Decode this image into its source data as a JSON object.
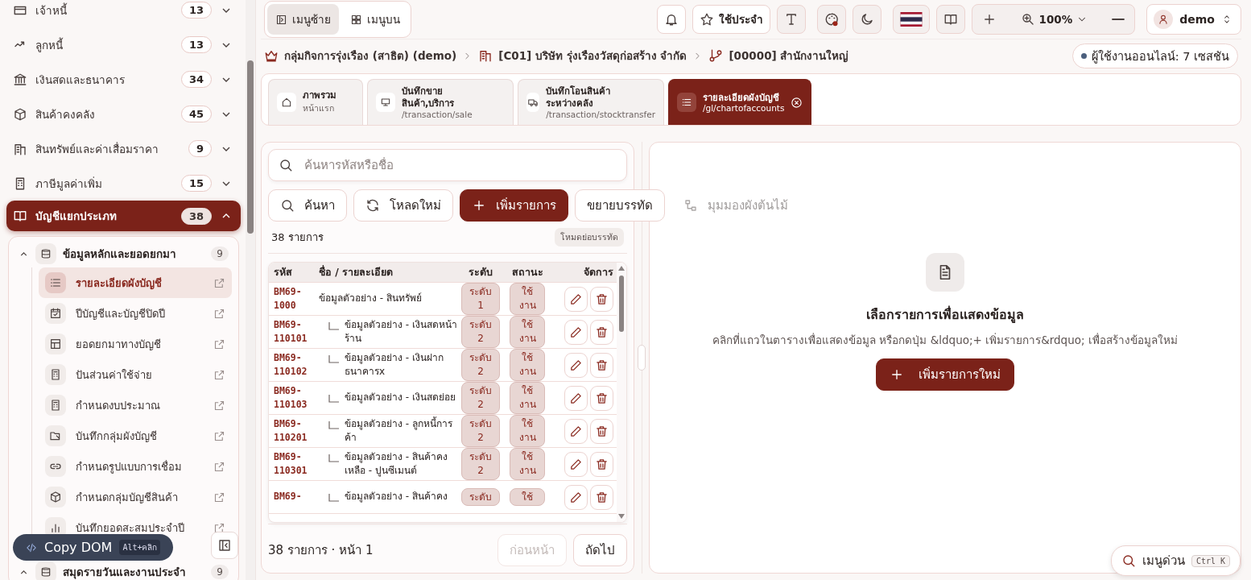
{
  "sidebar": {
    "items": [
      {
        "label": "เจ้าหนี้",
        "count": "13",
        "expanded": false,
        "selected": false
      },
      {
        "label": "ลูกหนี้",
        "count": "13",
        "expanded": false,
        "selected": false
      },
      {
        "label": "เงินสดและธนาคาร",
        "count": "34",
        "expanded": false,
        "selected": false
      },
      {
        "label": "สินค้าคงคลัง",
        "count": "45",
        "expanded": false,
        "selected": false
      },
      {
        "label": "สินทรัพย์และค่าเสื่อมราคา",
        "count": "9",
        "expanded": false,
        "selected": false
      },
      {
        "label": "ภาษีมูลค่าเพิ่ม",
        "count": "15",
        "expanded": false,
        "selected": false
      },
      {
        "label": "บัญชีแยกประเภท",
        "count": "38",
        "expanded": true,
        "selected": true,
        "children": [
          {
            "label": "ข้อมูลหลักและยอดยกมา",
            "count": "9",
            "expanded": true,
            "children": [
              {
                "label": "รายละเอียดผังบัญชี",
                "selected": true
              },
              {
                "label": "ปีบัญชีและบัญชีปิดปี",
                "selected": false
              },
              {
                "label": "ยอดยกมาทางบัญชี",
                "selected": false
              },
              {
                "label": "ปันส่วนค่าใช้จ่าย",
                "selected": false
              },
              {
                "label": "กำหนดงบประมาณ",
                "selected": false
              },
              {
                "label": "บันทึกกลุ่มผังบัญชี",
                "selected": false
              },
              {
                "label": "กำหนดรูปแบบการเชื่อม",
                "selected": false
              },
              {
                "label": "กำหนดกลุ่มบัญชีสินค้า",
                "selected": false
              },
              {
                "label": "บันทึกยอดสะสมประจำปี",
                "selected": false
              }
            ]
          },
          {
            "label": "สมุดรายวันและงานประจำ",
            "count": "9",
            "expanded": true
          }
        ]
      }
    ]
  },
  "copy_dom": {
    "label": "Copy DOM",
    "shortcut": "Alt+คลิก"
  },
  "toolbar": {
    "layout_modes": [
      {
        "label": "เมนูซ้าย",
        "selected": true
      },
      {
        "label": "เมนูบน",
        "selected": false
      }
    ],
    "favorites": "ใช้ประจำ",
    "zoom": "100%",
    "user": "demo"
  },
  "breadcrumb": [
    "กลุ่มกิจการรุ่งเรือง (สาธิต) (demo)",
    "[C01] บริษัท รุ่งเรืองวัสดุก่อสร้าง จำกัด",
    "[00000] สำนักงานใหญ่"
  ],
  "online_status": "ผู้ใช้งานออนไลน์: 7 เซสชัน",
  "tabs": [
    {
      "title": "ภาพรวม",
      "subtitle": "หน้าแรก",
      "selected": false
    },
    {
      "title": "บันทึกขาย\nสินค้า,บริการ",
      "subtitle": "/transaction/sale",
      "selected": false
    },
    {
      "title": "บันทึกโอนสินค้า\nระหว่างคลัง",
      "subtitle": "/transaction/stocktransfer",
      "selected": false
    },
    {
      "title": "รายละเอียดผังบัญชี",
      "subtitle": "/gl/chartofaccounts",
      "selected": true
    }
  ],
  "list_panel": {
    "search": {
      "placeholder": "ค้นหารหัสหรือชื่อ"
    },
    "buttons": [
      {
        "label": "ค้นหา",
        "kind": "search",
        "disabled": false
      },
      {
        "label": "โหลดใหม่",
        "kind": "reload",
        "disabled": false
      },
      {
        "label": "เพิ่มรายการ",
        "kind": "add",
        "disabled": false
      },
      {
        "label": "ขยายบรรทัด",
        "kind": "expand",
        "disabled": false
      },
      {
        "label": "มุมมองผังต้นไม้",
        "kind": "tree",
        "disabled": true
      }
    ],
    "count": "38 รายการ",
    "mode_badge": "โหมดย่อบรรทัด",
    "table": {
      "columns": [
        "รหัส",
        "ชื่อ / รายละเอียด",
        "ระดับ",
        "สถานะ",
        "จัดการ"
      ],
      "rows": [
        {
          "code": "BM69-1000",
          "name": "ข้อมูลตัวอย่าง - สินทรัพย์",
          "level": "ระดับ 1",
          "status": "ใช้งาน",
          "children": [
            {
              "code": "BM69-110101",
              "name": "ข้อมูลตัวอย่าง - เงินสดหน้าร้าน",
              "level": "ระดับ 2",
              "status": "ใช้งาน"
            },
            {
              "code": "BM69-110102",
              "name": "ข้อมูลตัวอย่าง - เงินฝากธนาคารx",
              "level": "ระดับ 2",
              "status": "ใช้งาน"
            },
            {
              "code": "BM69-110103",
              "name": "ข้อมูลตัวอย่าง - เงินสดย่อย",
              "level": "ระดับ 2",
              "status": "ใช้งาน"
            },
            {
              "code": "BM69-110201",
              "name": "ข้อมูลตัวอย่าง - ลูกหนี้การค้า",
              "level": "ระดับ 2",
              "status": "ใช้งาน"
            },
            {
              "code": "BM69-110301",
              "name": "ข้อมูลตัวอย่าง - สินค้าคงเหลือ - ปูนซีเมนต์",
              "level": "ระดับ 2",
              "status": "ใช้งาน"
            },
            {
              "code": "BM69-",
              "name": "ข้อมูลตัวอย่าง - สินค้าคง",
              "level": "ระดับ",
              "status": "ใช้"
            }
          ]
        }
      ]
    },
    "footer": "38 รายการ · หน้า 1",
    "pager": [
      {
        "label": "ก่อนหน้า",
        "disabled": true
      },
      {
        "label": "ถัดไป",
        "disabled": false
      }
    ]
  },
  "detail_panel": {
    "title": "เลือกรายการเพื่อแสดงข้อมูล",
    "description": "คลิกที่แถวในตารางเพื่อแสดงข้อมูล หรือกดปุ่ม &ldquo;+ เพิ่มรายการ&rdquo; เพื่อสร้างข้อมูลใหม่",
    "button": "เพิ่มรายการใหม่"
  },
  "quick_menu": {
    "label": "เมนูด่วน",
    "shortcut": "Ctrl K"
  }
}
